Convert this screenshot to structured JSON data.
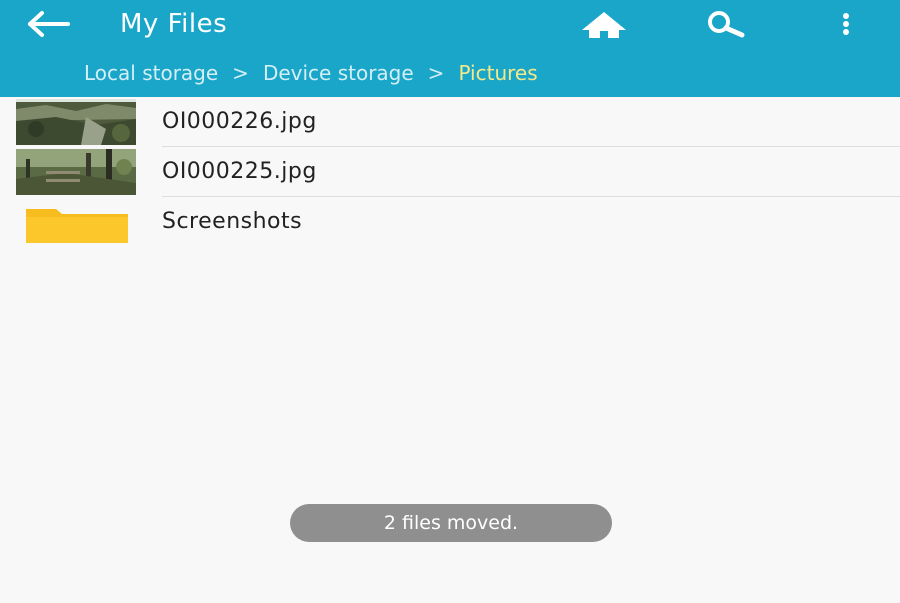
{
  "header": {
    "title": "My Files",
    "back_icon": "arrow-left-icon",
    "actions": [
      {
        "name": "home",
        "icon": "home-icon"
      },
      {
        "name": "search",
        "icon": "search-icon"
      },
      {
        "name": "more",
        "icon": "more-vertical-icon"
      }
    ],
    "background_color": "#1aa6c9"
  },
  "breadcrumb": {
    "items": [
      "Local storage",
      "Device storage",
      "Pictures"
    ],
    "separator": ">",
    "current_color": "#f4e98a"
  },
  "files": [
    {
      "name": "OI000226.jpg",
      "type": "image",
      "icon": "image-thumbnail-icon"
    },
    {
      "name": "OI000225.jpg",
      "type": "image",
      "icon": "image-thumbnail-icon"
    },
    {
      "name": "Screenshots",
      "type": "folder",
      "icon": "folder-icon"
    }
  ],
  "toast": {
    "message": "2 files moved."
  }
}
